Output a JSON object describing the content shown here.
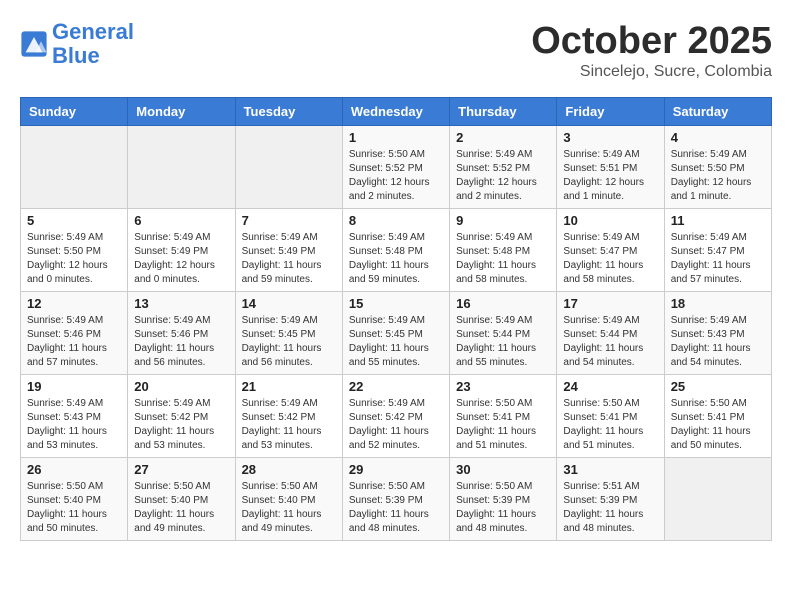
{
  "header": {
    "logo_line1": "General",
    "logo_line2": "Blue",
    "month": "October 2025",
    "location": "Sincelejo, Sucre, Colombia"
  },
  "weekdays": [
    "Sunday",
    "Monday",
    "Tuesday",
    "Wednesday",
    "Thursday",
    "Friday",
    "Saturday"
  ],
  "weeks": [
    [
      {
        "day": "",
        "info": ""
      },
      {
        "day": "",
        "info": ""
      },
      {
        "day": "",
        "info": ""
      },
      {
        "day": "1",
        "info": "Sunrise: 5:50 AM\nSunset: 5:52 PM\nDaylight: 12 hours\nand 2 minutes."
      },
      {
        "day": "2",
        "info": "Sunrise: 5:49 AM\nSunset: 5:52 PM\nDaylight: 12 hours\nand 2 minutes."
      },
      {
        "day": "3",
        "info": "Sunrise: 5:49 AM\nSunset: 5:51 PM\nDaylight: 12 hours\nand 1 minute."
      },
      {
        "day": "4",
        "info": "Sunrise: 5:49 AM\nSunset: 5:50 PM\nDaylight: 12 hours\nand 1 minute."
      }
    ],
    [
      {
        "day": "5",
        "info": "Sunrise: 5:49 AM\nSunset: 5:50 PM\nDaylight: 12 hours\nand 0 minutes."
      },
      {
        "day": "6",
        "info": "Sunrise: 5:49 AM\nSunset: 5:49 PM\nDaylight: 12 hours\nand 0 minutes."
      },
      {
        "day": "7",
        "info": "Sunrise: 5:49 AM\nSunset: 5:49 PM\nDaylight: 11 hours\nand 59 minutes."
      },
      {
        "day": "8",
        "info": "Sunrise: 5:49 AM\nSunset: 5:48 PM\nDaylight: 11 hours\nand 59 minutes."
      },
      {
        "day": "9",
        "info": "Sunrise: 5:49 AM\nSunset: 5:48 PM\nDaylight: 11 hours\nand 58 minutes."
      },
      {
        "day": "10",
        "info": "Sunrise: 5:49 AM\nSunset: 5:47 PM\nDaylight: 11 hours\nand 58 minutes."
      },
      {
        "day": "11",
        "info": "Sunrise: 5:49 AM\nSunset: 5:47 PM\nDaylight: 11 hours\nand 57 minutes."
      }
    ],
    [
      {
        "day": "12",
        "info": "Sunrise: 5:49 AM\nSunset: 5:46 PM\nDaylight: 11 hours\nand 57 minutes."
      },
      {
        "day": "13",
        "info": "Sunrise: 5:49 AM\nSunset: 5:46 PM\nDaylight: 11 hours\nand 56 minutes."
      },
      {
        "day": "14",
        "info": "Sunrise: 5:49 AM\nSunset: 5:45 PM\nDaylight: 11 hours\nand 56 minutes."
      },
      {
        "day": "15",
        "info": "Sunrise: 5:49 AM\nSunset: 5:45 PM\nDaylight: 11 hours\nand 55 minutes."
      },
      {
        "day": "16",
        "info": "Sunrise: 5:49 AM\nSunset: 5:44 PM\nDaylight: 11 hours\nand 55 minutes."
      },
      {
        "day": "17",
        "info": "Sunrise: 5:49 AM\nSunset: 5:44 PM\nDaylight: 11 hours\nand 54 minutes."
      },
      {
        "day": "18",
        "info": "Sunrise: 5:49 AM\nSunset: 5:43 PM\nDaylight: 11 hours\nand 54 minutes."
      }
    ],
    [
      {
        "day": "19",
        "info": "Sunrise: 5:49 AM\nSunset: 5:43 PM\nDaylight: 11 hours\nand 53 minutes."
      },
      {
        "day": "20",
        "info": "Sunrise: 5:49 AM\nSunset: 5:42 PM\nDaylight: 11 hours\nand 53 minutes."
      },
      {
        "day": "21",
        "info": "Sunrise: 5:49 AM\nSunset: 5:42 PM\nDaylight: 11 hours\nand 53 minutes."
      },
      {
        "day": "22",
        "info": "Sunrise: 5:49 AM\nSunset: 5:42 PM\nDaylight: 11 hours\nand 52 minutes."
      },
      {
        "day": "23",
        "info": "Sunrise: 5:50 AM\nSunset: 5:41 PM\nDaylight: 11 hours\nand 51 minutes."
      },
      {
        "day": "24",
        "info": "Sunrise: 5:50 AM\nSunset: 5:41 PM\nDaylight: 11 hours\nand 51 minutes."
      },
      {
        "day": "25",
        "info": "Sunrise: 5:50 AM\nSunset: 5:41 PM\nDaylight: 11 hours\nand 50 minutes."
      }
    ],
    [
      {
        "day": "26",
        "info": "Sunrise: 5:50 AM\nSunset: 5:40 PM\nDaylight: 11 hours\nand 50 minutes."
      },
      {
        "day": "27",
        "info": "Sunrise: 5:50 AM\nSunset: 5:40 PM\nDaylight: 11 hours\nand 49 minutes."
      },
      {
        "day": "28",
        "info": "Sunrise: 5:50 AM\nSunset: 5:40 PM\nDaylight: 11 hours\nand 49 minutes."
      },
      {
        "day": "29",
        "info": "Sunrise: 5:50 AM\nSunset: 5:39 PM\nDaylight: 11 hours\nand 48 minutes."
      },
      {
        "day": "30",
        "info": "Sunrise: 5:50 AM\nSunset: 5:39 PM\nDaylight: 11 hours\nand 48 minutes."
      },
      {
        "day": "31",
        "info": "Sunrise: 5:51 AM\nSunset: 5:39 PM\nDaylight: 11 hours\nand 48 minutes."
      },
      {
        "day": "",
        "info": ""
      }
    ]
  ]
}
